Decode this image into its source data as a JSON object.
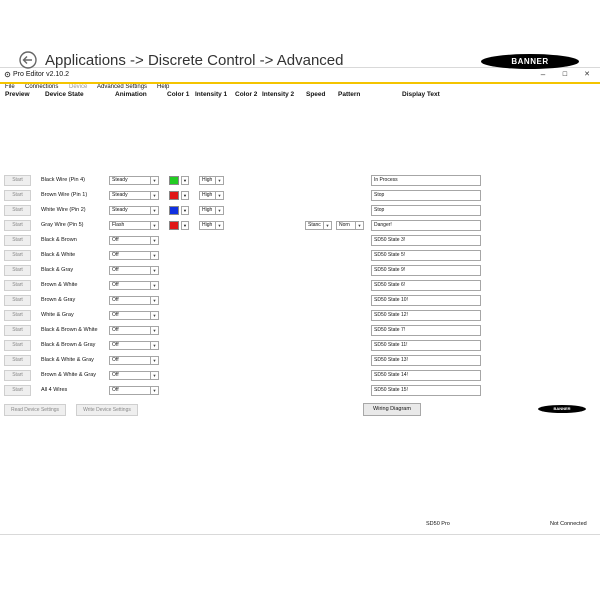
{
  "window": {
    "title": "Pro Editor v2.10.2",
    "minimize": "–",
    "maximize": "☐",
    "close": "✕"
  },
  "menu": [
    "File",
    "Connections",
    "Device",
    "Advanced Settings",
    "Help"
  ],
  "header": {
    "title": "Applications -> Discrete Control -> Advanced",
    "logo": "BANNER"
  },
  "columns": {
    "preview": "Preview",
    "device_state": "Device State",
    "animation": "Animation",
    "color1": "Color 1",
    "intensity1": "Intensity 1",
    "color2": "Color 2",
    "intensity2": "Intensity 2",
    "speed": "Speed",
    "pattern": "Pattern",
    "display_text": "Display Text"
  },
  "colors": {
    "accent": "#f4c400",
    "green": "#22cc22",
    "red": "#e01818",
    "blue": "#1030e0"
  },
  "rows": [
    {
      "start": "Start",
      "state": "Black Wire (Pin 4)",
      "animation": "Steady",
      "color1": "#22cc22",
      "intensity1": "High",
      "speed": "",
      "pattern": "",
      "text": "In Process"
    },
    {
      "start": "Start",
      "state": "Brown Wire (Pin 1)",
      "animation": "Steady",
      "color1": "#e01818",
      "intensity1": "High",
      "speed": "",
      "pattern": "",
      "text": "Stop"
    },
    {
      "start": "Start",
      "state": "White Wire (Pin 2)",
      "animation": "Steady",
      "color1": "#1030e0",
      "intensity1": "High",
      "speed": "",
      "pattern": "",
      "text": "Stop"
    },
    {
      "start": "Start",
      "state": "Gray Wire (Pin 5)",
      "animation": "Flash",
      "color1": "#e01818",
      "intensity1": "High",
      "speed": "Stanc",
      "pattern": "Norn",
      "text": "Danger!"
    },
    {
      "start": "Start",
      "state": "Black & Brown",
      "animation": "Off",
      "color1": "",
      "intensity1": "",
      "speed": "",
      "pattern": "",
      "text": "SD50 State 3!"
    },
    {
      "start": "Start",
      "state": "Black & White",
      "animation": "Off",
      "color1": "",
      "intensity1": "",
      "speed": "",
      "pattern": "",
      "text": "SD50 State 5!"
    },
    {
      "start": "Start",
      "state": "Black & Gray",
      "animation": "Off",
      "color1": "",
      "intensity1": "",
      "speed": "",
      "pattern": "",
      "text": "SD50 State 9!"
    },
    {
      "start": "Start",
      "state": "Brown & White",
      "animation": "Off",
      "color1": "",
      "intensity1": "",
      "speed": "",
      "pattern": "",
      "text": "SD50 State 6!"
    },
    {
      "start": "Start",
      "state": "Brown & Gray",
      "animation": "Off",
      "color1": "",
      "intensity1": "",
      "speed": "",
      "pattern": "",
      "text": "SD50 State 10!"
    },
    {
      "start": "Start",
      "state": "White & Gray",
      "animation": "Off",
      "color1": "",
      "intensity1": "",
      "speed": "",
      "pattern": "",
      "text": "SD50 State 12!"
    },
    {
      "start": "Start",
      "state": "Black & Brown & White",
      "animation": "Off",
      "color1": "",
      "intensity1": "",
      "speed": "",
      "pattern": "",
      "text": "SD50 State 7!"
    },
    {
      "start": "Start",
      "state": "Black & Brown & Gray",
      "animation": "Off",
      "color1": "",
      "intensity1": "",
      "speed": "",
      "pattern": "",
      "text": "SD50 State 11!"
    },
    {
      "start": "Start",
      "state": "Black & White & Gray",
      "animation": "Off",
      "color1": "",
      "intensity1": "",
      "speed": "",
      "pattern": "",
      "text": "SD50 State 13!"
    },
    {
      "start": "Start",
      "state": "Brown & White & Gray",
      "animation": "Off",
      "color1": "",
      "intensity1": "",
      "speed": "",
      "pattern": "",
      "text": "SD50 State 14!"
    },
    {
      "start": "Start",
      "state": "All 4 Wires",
      "animation": "Off",
      "color1": "",
      "intensity1": "",
      "speed": "",
      "pattern": "",
      "text": "SD50 State 15!"
    }
  ],
  "buttons": {
    "read": "Read Device Settings",
    "write": "Write Device Settings",
    "wiring": "Wiring Diagram"
  },
  "footer_logo": "BANNER",
  "status": {
    "model": "SD50 Pro",
    "connection": "Not Connected"
  }
}
